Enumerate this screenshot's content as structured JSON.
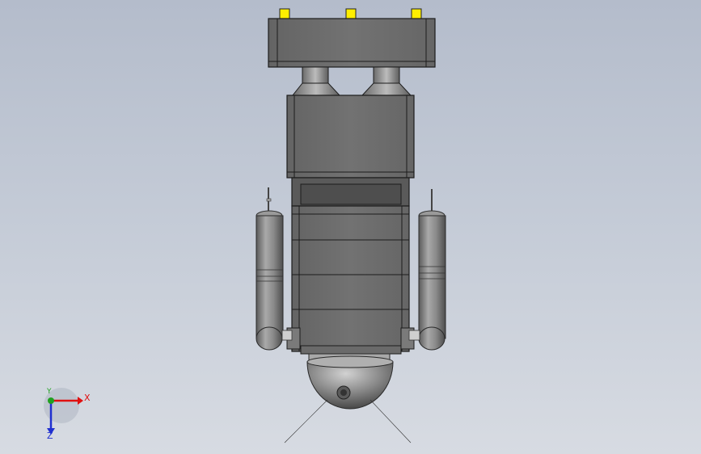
{
  "viewport": {
    "background_top": "#b4bccb",
    "background_bottom": "#d7dbe2"
  },
  "model": {
    "body_color": "#6e6e6e",
    "edge_color": "#1c1c1c",
    "connector_color": "#ffee00",
    "cylinder_color": "#8a8a8a",
    "dome_color": "#8f8f8f"
  },
  "triad": {
    "x_label": "X",
    "y_label": "Y",
    "z_label": "Z",
    "x_color": "#e01010",
    "y_color": "#20a020",
    "z_color": "#2030d0"
  }
}
